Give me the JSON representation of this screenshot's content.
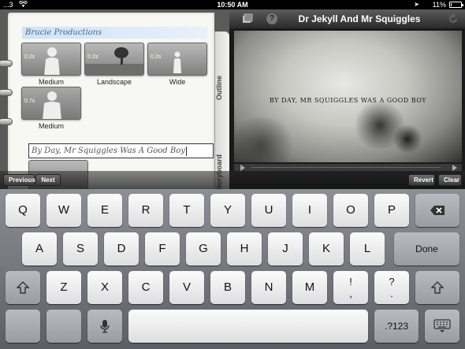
{
  "status_bar": {
    "carrier": "...3",
    "time": "10:50 AM",
    "battery_text": "11%",
    "battery_level": 0.11
  },
  "notebook": {
    "project_name": "Brucie Productions",
    "tabs": [
      "Outline",
      "Storyboard"
    ],
    "shots": [
      {
        "duration": "0.2s",
        "label": "Medium"
      },
      {
        "duration": "0.2s",
        "label": "Landscape"
      },
      {
        "duration": "0.2s",
        "label": "Wide"
      },
      {
        "duration": "0.7s",
        "label": "Medium"
      }
    ],
    "dialog_text": "By Day, Mr Squiggles Was A Good Boy"
  },
  "preview": {
    "title": "Dr Jekyll And Mr Squiggles",
    "help_label": "?",
    "caption": "BY DAY, MR SQUIGGLES WAS A GOOD BOY"
  },
  "accessory_bar": {
    "previous": "Previous",
    "next": "Next",
    "revert": "Revert",
    "clear": "Clear"
  },
  "keyboard": {
    "row1": [
      "Q",
      "W",
      "E",
      "R",
      "T",
      "Y",
      "U",
      "I",
      "O",
      "P"
    ],
    "row2": [
      "A",
      "S",
      "D",
      "F",
      "G",
      "H",
      "J",
      "K",
      "L"
    ],
    "row3": [
      "Z",
      "X",
      "C",
      "V",
      "B",
      "N",
      "M"
    ],
    "done": "Done",
    "exclaim_top": "!",
    "exclaim_bottom": ",",
    "question_top": "?",
    "question_bottom": ".",
    "numbers": ".?123"
  }
}
